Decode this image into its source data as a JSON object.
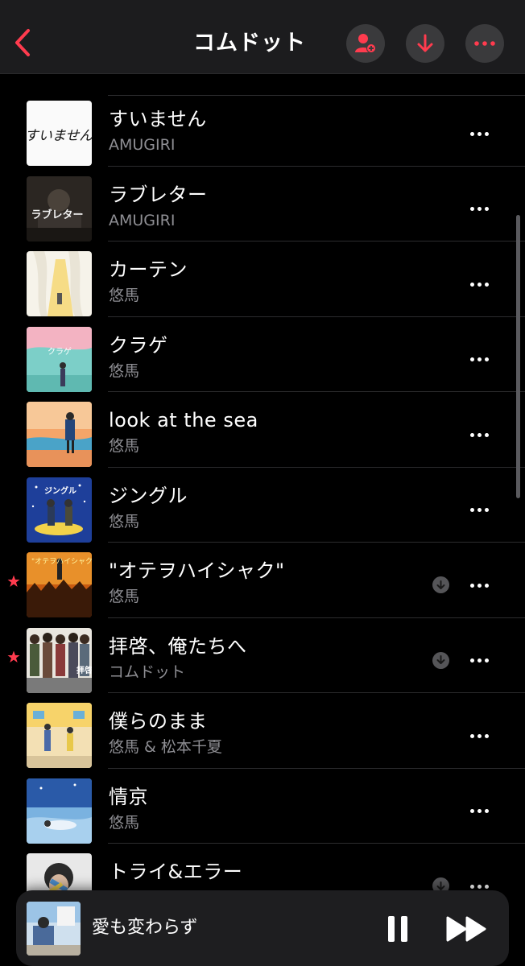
{
  "header": {
    "title": "コムドット",
    "accent_color": "#ff3b4e",
    "back_icon": "chevron-left-icon",
    "add_icon": "person-add-icon",
    "download_icon": "arrow-down-icon",
    "more_icon": "ellipsis-icon"
  },
  "songs": [
    {
      "title": "すいません",
      "artist": "AMUGIRI",
      "art_text": "すいません"
    },
    {
      "title": "ラブレター",
      "artist": "AMUGIRI",
      "art_text": "ラブレター"
    },
    {
      "title": "カーテン",
      "artist": "悠馬"
    },
    {
      "title": "クラゲ",
      "artist": "悠馬",
      "art_text": "クラゲ"
    },
    {
      "title": "look at the sea",
      "artist": "悠馬"
    },
    {
      "title": "ジングル",
      "artist": "悠馬",
      "art_text": "ジングル"
    },
    {
      "title": "\"オテヲハイシャク\"",
      "artist": "悠馬",
      "starred": true,
      "downloaded": true
    },
    {
      "title": "拝啓、俺たちへ",
      "artist": "コムドット",
      "starred": true,
      "downloaded": true
    },
    {
      "title": "僕らのまま",
      "artist": "悠馬 & 松本千夏"
    },
    {
      "title": "情京",
      "artist": "悠馬"
    },
    {
      "title": "トライ&エラー",
      "artist": "",
      "downloaded": true
    }
  ],
  "player": {
    "title": "愛も変わらず",
    "pause_icon": "pause-icon",
    "forward_icon": "fast-forward-icon"
  }
}
